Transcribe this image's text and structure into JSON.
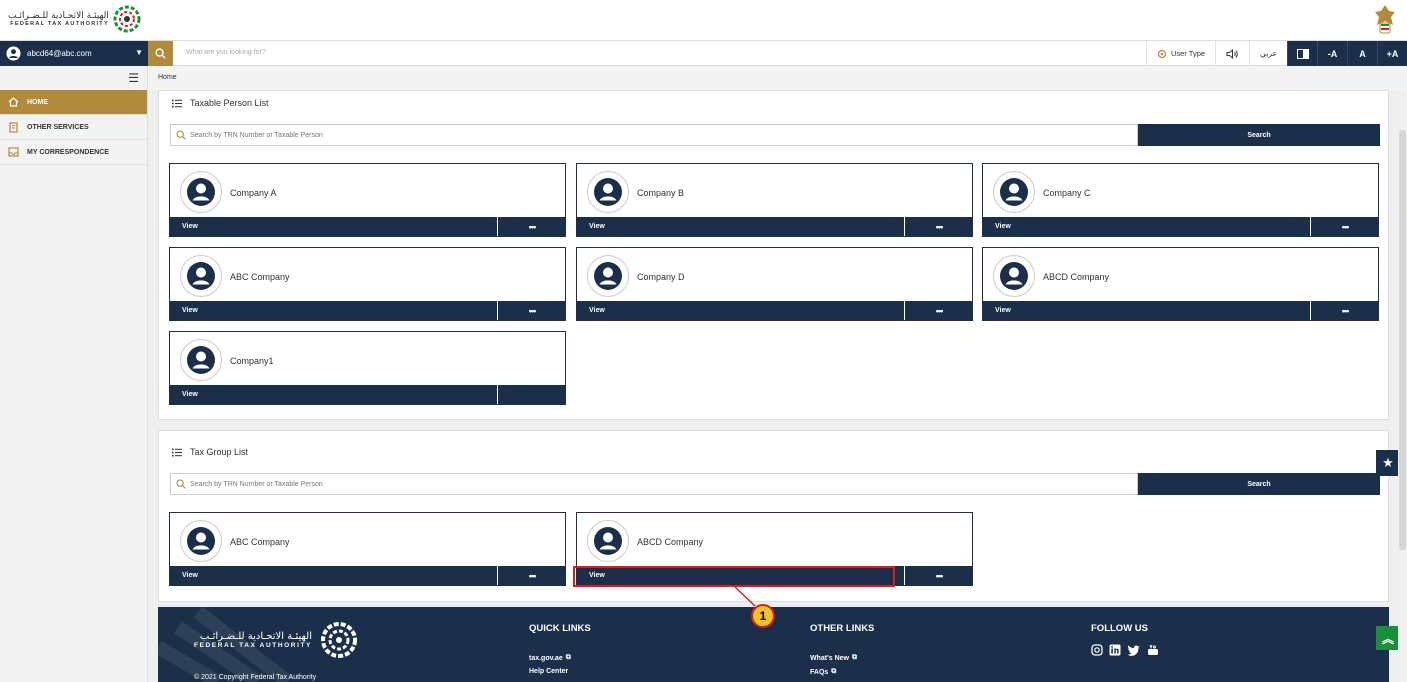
{
  "header": {
    "logo_ar": "الهيئـة الاتحـادية للـضـرائـب",
    "logo_en": "FEDERAL TAX AUTHORITY",
    "logo_icon": "fta-emblem-icon",
    "emblem_icon": "uae-emblem-icon"
  },
  "navbar": {
    "user_email": "abcd64@abc.com",
    "search_placeholder": "What are you looking for?",
    "user_type_label": "User Type",
    "arabic_label": "عربي",
    "font_decrease": "-A",
    "font_normal": "A",
    "font_increase": "+A"
  },
  "sidebar": {
    "items": [
      {
        "label": "HOME",
        "icon": "home-icon",
        "active": true
      },
      {
        "label": "OTHER SERVICES",
        "icon": "building-icon",
        "active": false
      },
      {
        "label": "MY CORRESPONDENCE",
        "icon": "inbox-icon",
        "active": false
      }
    ]
  },
  "breadcrumb": "Home",
  "taxable_person_list": {
    "title": "Taxable Person List",
    "search_placeholder": "Search by TRN Number or Taxable Person",
    "search_button": "Search",
    "cards": [
      {
        "name": "Company A",
        "view": "View",
        "more": "•••"
      },
      {
        "name": "Company B",
        "view": "View",
        "more": "•••"
      },
      {
        "name": "Company C",
        "view": "View",
        "more": "•••"
      },
      {
        "name": "ABC Company",
        "view": "View",
        "more": "•••"
      },
      {
        "name": "Company D",
        "view": "View",
        "more": "•••"
      },
      {
        "name": "ABCD Company",
        "view": "View",
        "more": "•••"
      },
      {
        "name": "Company1",
        "view": "View",
        "more": ""
      }
    ]
  },
  "tax_group_list": {
    "title": "Tax Group List",
    "search_placeholder": "Search by TRN Number or Taxable Person",
    "search_button": "Search",
    "cards": [
      {
        "name": "ABC Company",
        "view": "View",
        "more": "•••"
      },
      {
        "name": "ABCD Company",
        "view": "View",
        "more": "•••"
      }
    ]
  },
  "callout_number": "1",
  "footer": {
    "logo_ar": "الهيئـة الاتحـادية للـضـرائـب",
    "logo_en": "FEDERAL TAX AUTHORITY",
    "copyright": "© 2021 Copyright Federal Tax Authority",
    "quick_links_title": "QUICK LINKS",
    "quick_links": [
      "tax.gov.ae",
      "Help Center"
    ],
    "other_links_title": "OTHER LINKS",
    "other_links": [
      "What's New",
      "FAQs"
    ],
    "follow_us_title": "FOLLOW US",
    "social_icons": [
      "instagram-icon",
      "linkedin-icon",
      "twitter-icon",
      "youtube-icon"
    ]
  },
  "colors": {
    "navy": "#1c2f4a",
    "gold": "#b28a3b",
    "highlight": "#d91e18",
    "callout": "#f2c12e",
    "green": "#1a8e3a"
  }
}
